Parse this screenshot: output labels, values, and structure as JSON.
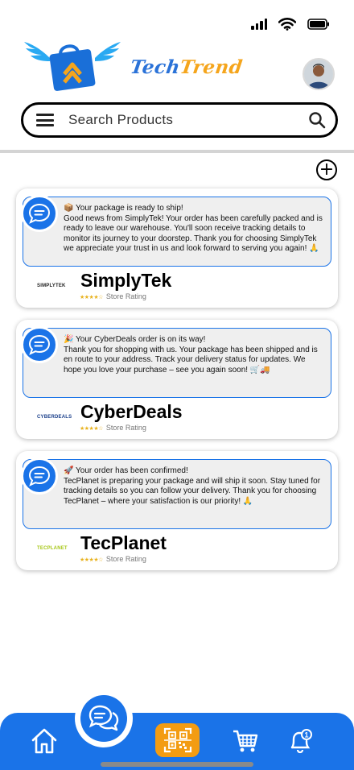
{
  "status_bar": {
    "icons": [
      "signal-icon",
      "wifi-icon",
      "battery-icon"
    ]
  },
  "header": {
    "brand_part1": "Tech",
    "brand_part2": "Trend",
    "brand_colors": {
      "tech": "#2a72d8",
      "trend": "#f5a51c"
    }
  },
  "search": {
    "placeholder": "Search Products"
  },
  "colors": {
    "accent": "#1a73e8",
    "scan": "#f39c12",
    "star": "#e8b21e"
  },
  "notifications": [
    {
      "title": "📦 Your package is ready to ship!",
      "body": "Good news from SimplyTek! Your order has been carefully packed and is ready to leave our warehouse. You'll soon receive tracking details to monitor its journey to your doorstep. Thank you for choosing SimplyTek we appreciate your trust in us and look forward to serving you again! 🙏",
      "store": "SimplyTek",
      "logo_text": "SIMPLYTEK",
      "stars": "★★★★☆",
      "rating_label": "Store Rating"
    },
    {
      "title": "🎉 Your CyberDeals order is on its way!",
      "body": "Thank you for shopping with us. Your package has been shipped and is en route to your address. Track your delivery status for updates. We hope you love your purchase – see you again soon! 🛒🚚",
      "store": "CyberDeals",
      "logo_text": "CYBERDEALS",
      "stars": "★★★★☆",
      "rating_label": "Store Rating"
    },
    {
      "title": "🚀 Your order has been confirmed!",
      "body": "TecPlanet is preparing your package and will ship it soon. Stay tuned for tracking details so you can follow your delivery. Thank you for choosing TecPlanet – where your satisfaction is our priority! 🙏",
      "store": "TecPlanet",
      "logo_text": "TECPLANET",
      "stars": "★★★★☆",
      "rating_label": "Store Rating"
    }
  ],
  "bottom_nav": {
    "items": [
      "home-icon",
      "chat-icon",
      "qr-scan-icon",
      "cart-icon",
      "notification-bell-icon"
    ],
    "notification_count": "1"
  }
}
